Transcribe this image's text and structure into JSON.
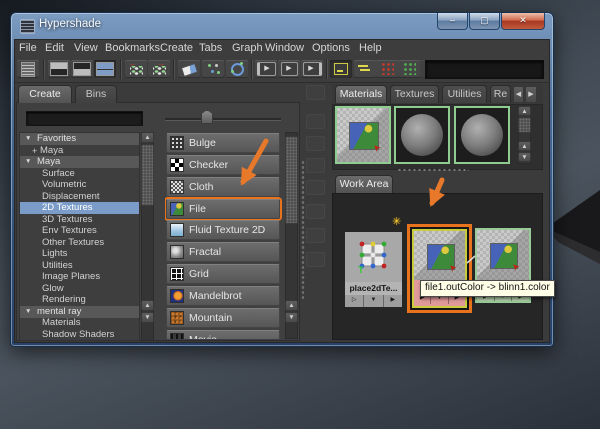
{
  "window": {
    "title": "Hypershade"
  },
  "menu": {
    "items": [
      "File",
      "Edit",
      "View",
      "Bookmarks",
      "Create",
      "Tabs",
      "Graph",
      "Window",
      "Options",
      "Help"
    ]
  },
  "toolbar": {
    "icon_names": [
      "node-list",
      "layout-top-pane",
      "layout-bottom-pane",
      "layout-split-panes",
      "previous-graph",
      "next-graph",
      "clear-graph",
      "rearrange-graph",
      "graph-selected",
      "show-input-connections",
      "show-input-output-connections",
      "show-output-connections",
      "toggle-create-bar",
      "collapse-attributes",
      "red-marker-grid",
      "green-marker-grid",
      "inactive-marker-grid"
    ],
    "field_value": ""
  },
  "left_panel": {
    "tabs": [
      {
        "label": "Create",
        "active": true
      },
      {
        "label": "Bins",
        "active": false
      }
    ],
    "filter": {
      "value": ""
    },
    "tree": {
      "items": [
        {
          "label": "Favorites",
          "kind": "group"
        },
        {
          "label": "Maya",
          "kind": "plus"
        },
        {
          "label": "Maya",
          "kind": "group"
        },
        {
          "label": "Surface",
          "kind": "item"
        },
        {
          "label": "Volumetric",
          "kind": "item"
        },
        {
          "label": "Displacement",
          "kind": "item"
        },
        {
          "label": "2D Textures",
          "kind": "item",
          "selected": true
        },
        {
          "label": "3D Textures",
          "kind": "item"
        },
        {
          "label": "Env Textures",
          "kind": "item"
        },
        {
          "label": "Other Textures",
          "kind": "item"
        },
        {
          "label": "Lights",
          "kind": "item"
        },
        {
          "label": "Utilities",
          "kind": "item"
        },
        {
          "label": "Image Planes",
          "kind": "item"
        },
        {
          "label": "Glow",
          "kind": "item"
        },
        {
          "label": "Rendering",
          "kind": "item"
        },
        {
          "label": "mental ray",
          "kind": "group"
        },
        {
          "label": "Materials",
          "kind": "item"
        },
        {
          "label": "Shadow Shaders",
          "kind": "item"
        }
      ]
    }
  },
  "create_list": {
    "items": [
      {
        "label": "Bulge"
      },
      {
        "label": "Checker"
      },
      {
        "label": "Cloth"
      },
      {
        "label": "File",
        "selected": true
      },
      {
        "label": "Fluid Texture 2D"
      },
      {
        "label": "Fractal"
      },
      {
        "label": "Grid"
      },
      {
        "label": "Mandelbrot"
      },
      {
        "label": "Mountain"
      },
      {
        "label": "Movie"
      }
    ]
  },
  "right_panel": {
    "tabs": {
      "items": [
        "Materials",
        "Textures",
        "Utilities",
        "Re"
      ],
      "active": "Materials"
    },
    "swatches": [
      {
        "name": "file-texture-swatch"
      },
      {
        "name": "material-sphere-swatch"
      },
      {
        "name": "material-sphere-swatch"
      }
    ],
    "work_area": {
      "tab": "Work Area",
      "nodes": {
        "place2d": {
          "label": "place2dTe..."
        },
        "file1": {
          "label": "file1"
        },
        "third": {
          "label": ""
        }
      },
      "tooltip": "file1.outColor -> blinn1.color"
    }
  },
  "icons": {
    "expand": "▼",
    "plus": "+",
    "up": "▲",
    "down": "▼",
    "left": "◀",
    "right": "▶",
    "tri_open": "▷",
    "tri_down": "▼",
    "tri_right": "▶",
    "star": "✳",
    "cursor": "➤",
    "back_arrow": "←",
    "fwd_arrow": "→",
    "minimize": "–",
    "maximize": "▢",
    "close": "✕"
  },
  "colors": {
    "accent_orange": "#E8731C",
    "selection_blue": "#7B9CC8",
    "swatch_green": "#8FCC8F",
    "node_pink": "#E09A9A",
    "tooltip_bg": "#FFFFE8",
    "title_blue": "#4A6C96"
  }
}
